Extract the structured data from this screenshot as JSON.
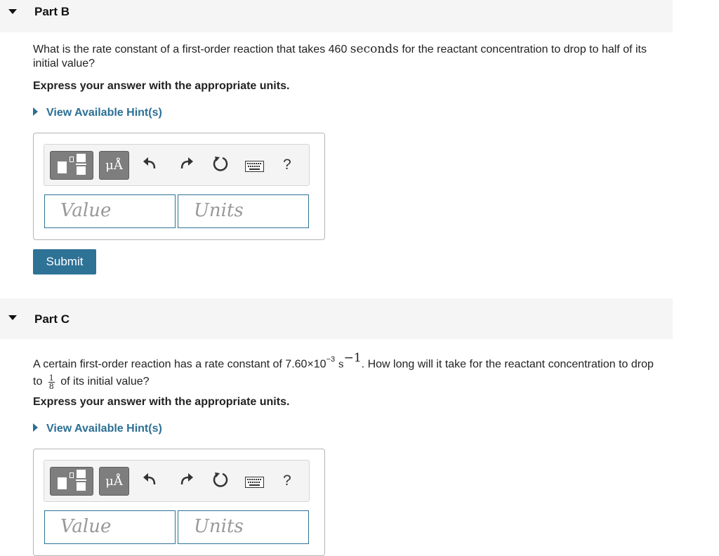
{
  "partB": {
    "title": "Part B",
    "question_pre": "What is the rate constant of a first-order reaction that takes 460 ",
    "question_unit": "seconds",
    "question_post": " for the reactant concentration to drop to half of its initial value?",
    "instruction": "Express your answer with the appropriate units.",
    "hint_label": "View Available Hint(s)",
    "value_placeholder": "Value",
    "units_placeholder": "Units",
    "submit_label": "Submit"
  },
  "partC": {
    "title": "Part C",
    "question_pre": "A certain first-order reaction has a rate constant of 7.60×10",
    "exponent": "−3",
    "unit_s": "s",
    "unit_exp": "−1",
    "question_mid": ". How long will it take for the reactant concentration to drop to ",
    "frac_num": "1",
    "frac_den": "8",
    "question_post": " of its initial value?",
    "instruction": "Express your answer with the appropriate units.",
    "hint_label": "View Available Hint(s)",
    "value_placeholder": "Value",
    "units_placeholder": "Units"
  },
  "toolbar": {
    "units_button": "μÅ",
    "help": "?",
    "icons": [
      "templates-icon",
      "units-icon",
      "undo-icon",
      "redo-icon",
      "reset-icon",
      "keyboard-icon",
      "help-icon"
    ]
  },
  "colors": {
    "accent": "#2e7296",
    "link": "#2b6f94",
    "header_bg": "#f5f5f5",
    "button_gray": "#7e7e7e"
  }
}
